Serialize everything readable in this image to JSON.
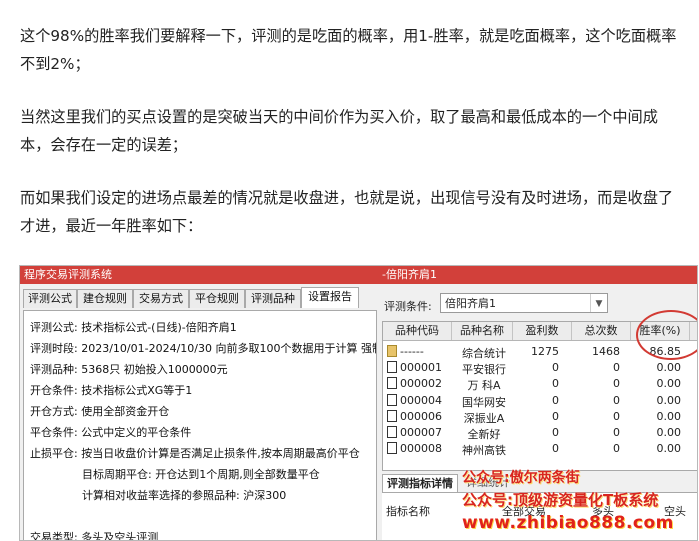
{
  "article": {
    "p1": "这个98%的胜率我们要解释一下，评测的是吃面的概率，用1-胜率，就是吃面概率，这个吃面概率不到2%；",
    "p2": "当然这里我们的买点设置的是突破当天的中间价作为买入价，取了最高和最低成本的一个中间成本，会存在一定的误差；",
    "p3": "而如果我们设定的进场点最差的情况就是收盘进，也就是说，出现信号没有及时进场，而是收盘了才进，最近一年胜率如下："
  },
  "window": {
    "title": "程序交易评测系统",
    "subtitle": "-倍阳齐肩1",
    "tabs": [
      "评测公式",
      "建仓规则",
      "交易方式",
      "平仓规则",
      "评测品种",
      "设置报告"
    ],
    "active_tab": "设置报告",
    "report": [
      "评测公式:  技术指标公式-(日线)-倍阳齐肩1",
      "评测时段:  2023/10/01-2024/10/30 向前多取100个数据用于计算 强制",
      "评测品种:  5368只 初始投入1000000元",
      "开仓条件:  技术指标公式XG等于1",
      "开仓方式:  使用全部资金开仓",
      "平仓条件:  公式中定义的平仓条件",
      "止损平仓:  按当日收盘价计算是否满足止损条件,按本周期最高价平仓",
      "目标周期平仓:  开仓达到1个周期,则全部数量平仓",
      "计算相对收益率选择的参照品种:  沪深300",
      "交易类型:  多头及空头评测"
    ],
    "condition_label": "评测条件:",
    "condition_value": "倍阳齐肩1",
    "grid": {
      "headers": [
        "品种代码",
        "品种名称",
        "盈利数",
        "总次数",
        "胜率(%)"
      ],
      "rows": [
        {
          "code": "------",
          "name": "综合统计",
          "win": "1275",
          "total": "1468",
          "rate": "86.85",
          "icon": "folder"
        },
        {
          "code": "000001",
          "name": "平安银行",
          "win": "0",
          "total": "0",
          "rate": "0.00",
          "icon": "file"
        },
        {
          "code": "000002",
          "name": "万 科A",
          "win": "0",
          "total": "0",
          "rate": "0.00",
          "icon": "file"
        },
        {
          "code": "000004",
          "name": "国华网安",
          "win": "0",
          "total": "0",
          "rate": "0.00",
          "icon": "file"
        },
        {
          "code": "000006",
          "name": "深振业A",
          "win": "0",
          "total": "0",
          "rate": "0.00",
          "icon": "file"
        },
        {
          "code": "000007",
          "name": "全新好",
          "win": "0",
          "total": "0",
          "rate": "0.00",
          "icon": "file"
        },
        {
          "code": "000008",
          "name": "神州高铁",
          "win": "0",
          "total": "0",
          "rate": "0.00",
          "icon": "file"
        }
      ]
    },
    "lower": {
      "tab1": "评测指标详情",
      "tab2": "详细统计",
      "col0": "指标名称",
      "col1": "全部交易",
      "col2": "多头",
      "col3": "空头"
    }
  },
  "watermark": {
    "line1": "公众号:傲尔两条街",
    "line2": "公众号:顶级游资量化T板系统",
    "line3": "www.zhibiao888.com"
  },
  "colors": {
    "title_bar": "#d2403a",
    "highlight_circle": "#d23a33",
    "watermark": "#d8251f"
  }
}
